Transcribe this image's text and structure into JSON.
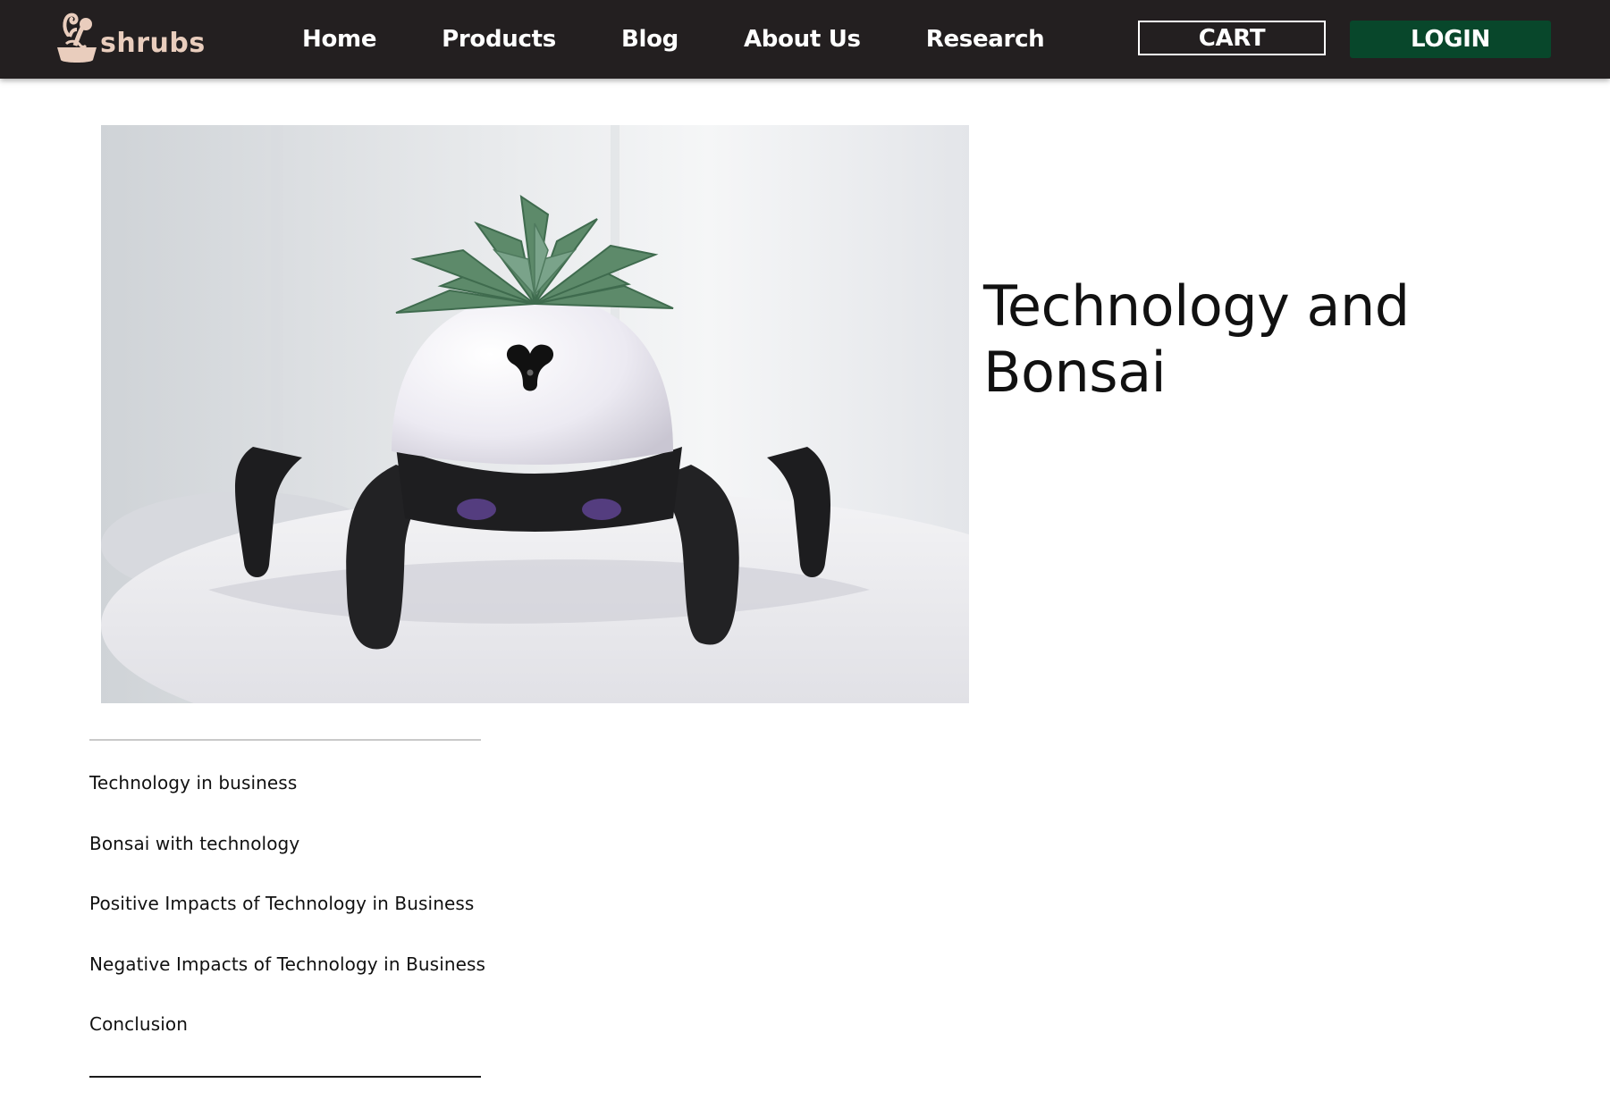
{
  "brand": {
    "name": "shrubs",
    "logo_icon": "bonsai-pot-icon",
    "logo_color": "#e9cdbd"
  },
  "nav": {
    "links": [
      {
        "label": "Home"
      },
      {
        "label": "Products"
      },
      {
        "label": "Blog"
      },
      {
        "label": "About Us"
      },
      {
        "label": "Research"
      }
    ],
    "cart_label": "CART",
    "login_label": "LOGIN",
    "background": "#231f20",
    "login_color": "#08472b"
  },
  "article": {
    "title": "Technology and Bonsai",
    "image": {
      "subject": "succulent-on-hexapod-robot"
    }
  },
  "toc": {
    "items": [
      {
        "label": "Technology in business"
      },
      {
        "label": "Bonsai with technology"
      },
      {
        "label": "Positive Impacts of Technology in Business"
      },
      {
        "label": "Negative Impacts of Technology in Business"
      },
      {
        "label": "Conclusion"
      }
    ]
  }
}
